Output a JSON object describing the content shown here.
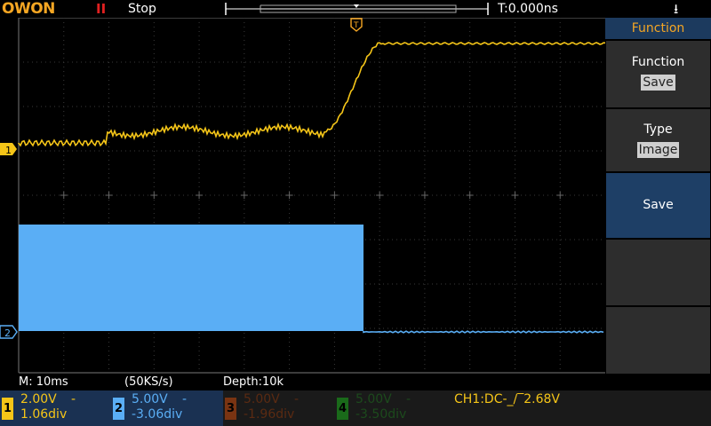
{
  "brand": {
    "logo_text": "OWON",
    "accent": "#f5a623"
  },
  "topbar": {
    "run_icon": "pause-icon",
    "run_icon_text": "II",
    "run_state": "Stop",
    "trigger_time": "T:0.000ns",
    "usb_icon": "usb-icon"
  },
  "menu": {
    "title": "Function",
    "items": [
      {
        "label": "Function",
        "value": "Save"
      },
      {
        "label": "Type",
        "value": "Image"
      },
      {
        "label": "Save"
      }
    ]
  },
  "status": {
    "mode": "M: 10ms",
    "sample_rate": "(50KS/s)",
    "depth": "Depth:10k"
  },
  "channels": [
    {
      "num": "1",
      "volts": "2.00V",
      "coupling": "-",
      "offset": "1.06div",
      "color": "#f5c518"
    },
    {
      "num": "2",
      "volts": "5.00V",
      "coupling": "-",
      "offset": "-3.06div",
      "color": "#5aaef5"
    },
    {
      "num": "3",
      "volts": "5.00V",
      "coupling": "-",
      "offset": "-1.96div",
      "color": "#7a3412"
    },
    {
      "num": "4",
      "volts": "5.00V",
      "coupling": "-",
      "offset": "-3.50div",
      "color": "#1a6a1a"
    }
  ],
  "trigger": {
    "info": "CH1:DC-_/‾2.68V"
  },
  "markers": {
    "ch1": "1",
    "ch2": "2",
    "trigger": "T"
  }
}
